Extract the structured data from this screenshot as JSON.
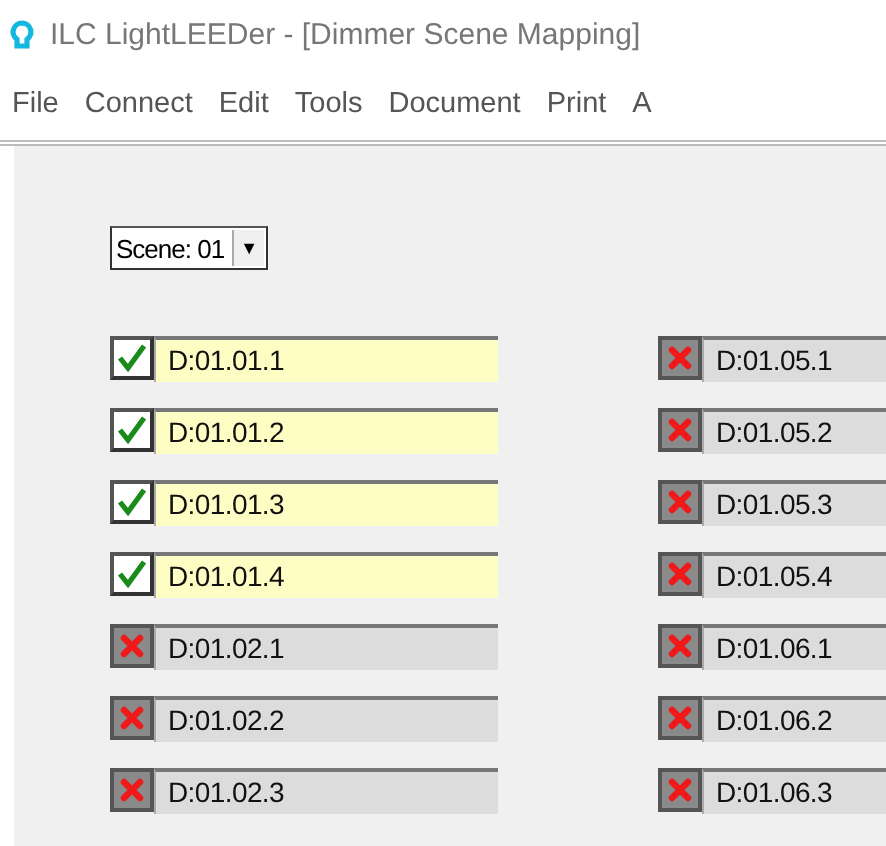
{
  "window": {
    "title": "ILC LightLEEDer - [Dimmer Scene Mapping]"
  },
  "menu": [
    "File",
    "Connect",
    "Edit",
    "Tools",
    "Document",
    "Print",
    "A"
  ],
  "scene_dropdown": {
    "value": "Scene: 01",
    "arrow": "▼"
  },
  "columns": [
    {
      "dimmers": [
        {
          "label": "D:01.01.1",
          "mapped": true
        },
        {
          "label": "D:01.01.2",
          "mapped": true
        },
        {
          "label": "D:01.01.3",
          "mapped": true
        },
        {
          "label": "D:01.01.4",
          "mapped": true
        },
        {
          "label": "D:01.02.1",
          "mapped": false
        },
        {
          "label": "D:01.02.2",
          "mapped": false
        },
        {
          "label": "D:01.02.3",
          "mapped": false
        }
      ]
    },
    {
      "dimmers": [
        {
          "label": "D:01.05.1",
          "mapped": false
        },
        {
          "label": "D:01.05.2",
          "mapped": false
        },
        {
          "label": "D:01.05.3",
          "mapped": false
        },
        {
          "label": "D:01.05.4",
          "mapped": false
        },
        {
          "label": "D:01.06.1",
          "mapped": false
        },
        {
          "label": "D:01.06.2",
          "mapped": false
        },
        {
          "label": "D:01.06.3",
          "mapped": false
        }
      ]
    }
  ]
}
